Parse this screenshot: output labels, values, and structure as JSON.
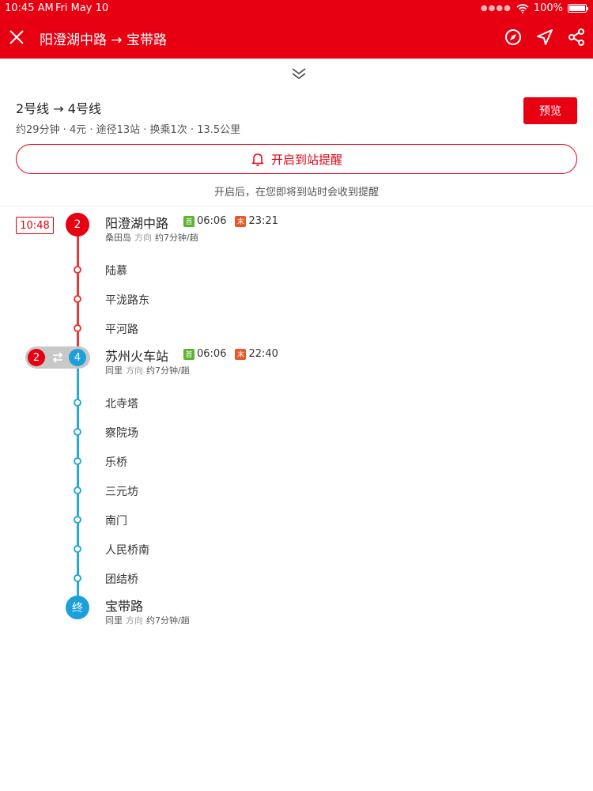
{
  "status_bar": {
    "time": "10:45 AM",
    "date": "Fri May 10",
    "battery": "100%"
  },
  "header": {
    "title": "阳澄湖中路 → 宝带路"
  },
  "summary": {
    "title": "2号线 → 4号线",
    "meta": "约29分钟 · 4元 · 途径13站 · 换乘1次 · 13.5公里",
    "preview_label": "预览"
  },
  "reminder": {
    "button_label": "开启到站提醒",
    "note": "开启后，在您即将到站时会收到提醒"
  },
  "route": {
    "depart_time": "10:48",
    "line1": {
      "number": "2",
      "color": "#e60012"
    },
    "line2": {
      "number": "4",
      "color": "#1ba0dc"
    },
    "end_label": "终",
    "start": {
      "name": "阳澄湖中路",
      "first_tag": "首",
      "first_time": "06:06",
      "last_tag": "末",
      "last_time": "23:21",
      "direction": "桑田岛",
      "direction_word": "方向",
      "interval": "约7分钟/趟"
    },
    "line1_stops": [
      "陆慕",
      "平泷路东",
      "平河路"
    ],
    "transfer": {
      "name": "苏州火车站",
      "first_tag": "首",
      "first_time": "06:06",
      "last_tag": "末",
      "last_time": "22:40",
      "direction": "同里",
      "direction_word": "方向",
      "interval": "约7分钟/趟"
    },
    "line2_stops": [
      "北寺塔",
      "察院场",
      "乐桥",
      "三元坊",
      "南门",
      "人民桥南",
      "团结桥"
    ],
    "end": {
      "name": "宝带路",
      "direction": "同里",
      "direction_word": "方向",
      "interval": "约7分钟/趟"
    }
  }
}
